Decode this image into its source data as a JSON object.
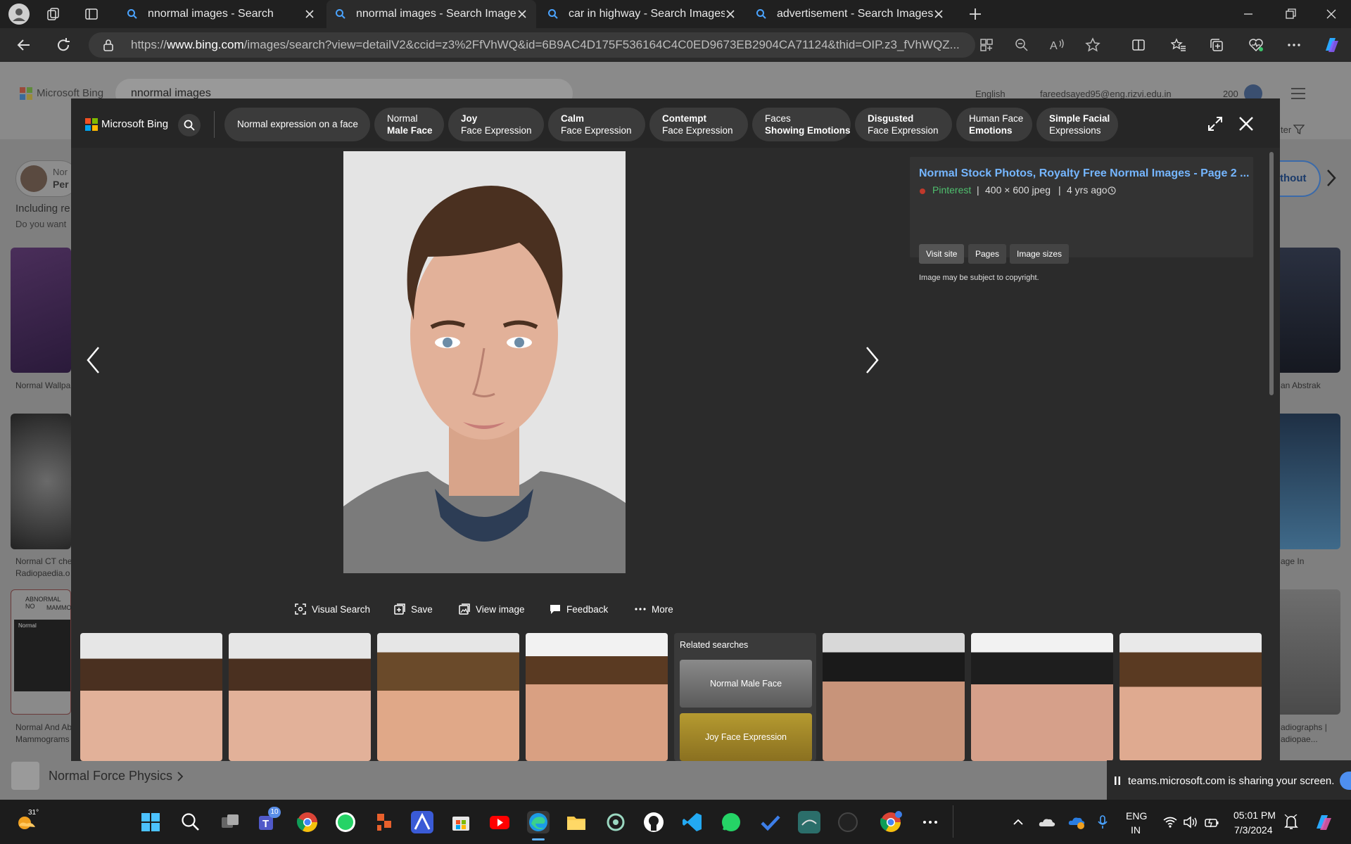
{
  "browser": {
    "tabs": [
      {
        "title": "nnormal images - Search"
      },
      {
        "title": "nnormal images - Search Images"
      },
      {
        "title": "car in highway - Search Images"
      },
      {
        "title": "advertisement - Search Images"
      }
    ],
    "url": {
      "prefix": "https://",
      "domain": "www.bing.com",
      "path": "/images/search?view=detailV2&ccid=z3%2FfVhWQ&id=6B9AC4D175F536164C4C0ED9673EB2904CA71124&thid=OIP.z3_fVhWQZ..."
    }
  },
  "background_page": {
    "logo": "Microsoft Bing",
    "search_query": "nnormal images",
    "language": "English",
    "account": "fareedsayed95@eng.rizvi.edu.in",
    "points": "200",
    "card_fragments": [
      "Nor",
      "Per"
    ],
    "including_text": "Including re",
    "do_you_want": "Do you want",
    "right_pill": "thout",
    "filter_text": "ter",
    "captions": [
      "Normal Wallpa",
      "Normal CT che",
      "Radiopaedia.o",
      "Normal And Ab",
      "Mammograms",
      "ABNORMAL NO",
      "MAMMO",
      "Normal",
      "an Abstrak",
      "age In",
      "adiographs |",
      "adiopae..."
    ],
    "footer_link": "Normal Force Physics"
  },
  "viewer": {
    "logo": "Microsoft Bing",
    "chips": [
      {
        "l1": "Normal expression on a face",
        "l2": ""
      },
      {
        "l1": "Normal",
        "l2": "Male Face"
      },
      {
        "l1": "Joy",
        "l2": "Face Expression"
      },
      {
        "l1": "Calm",
        "l2": "Face Expression"
      },
      {
        "l1": "Contempt",
        "l2": "Face Expression"
      },
      {
        "l1": "Faces",
        "l2": "Showing Emotions"
      },
      {
        "l1": "Disgusted",
        "l2": "Face Expression"
      },
      {
        "l1": "Human Face",
        "l2": "Emotions"
      },
      {
        "l1": "Simple Facial",
        "l2": "Expressions"
      }
    ],
    "info": {
      "title": "Normal Stock Photos, Royalty Free Normal Images - Page 2 ...",
      "source": "Pinterest",
      "size": "400 × 600 jpeg",
      "age": "4 yrs ago",
      "buttons": [
        "Visit site",
        "Pages",
        "Image sizes"
      ],
      "copyright": "Image may be subject to copyright."
    },
    "actions": [
      "Visual Search",
      "Save",
      "View image",
      "Feedback",
      "More"
    ],
    "related": {
      "heading": "Related searches",
      "items": [
        "Normal Male Face",
        "Joy Face Expression"
      ]
    }
  },
  "share_banner": "teams.microsoft.com is sharing your screen.",
  "taskbar": {
    "weather": "31°",
    "teams_badge": "10",
    "lang1": "ENG",
    "lang2": "IN",
    "time": "05:01 PM",
    "date": "7/3/2024"
  },
  "colors": {
    "accent": "#75b6ff",
    "bing_link": "#75b6ff"
  }
}
